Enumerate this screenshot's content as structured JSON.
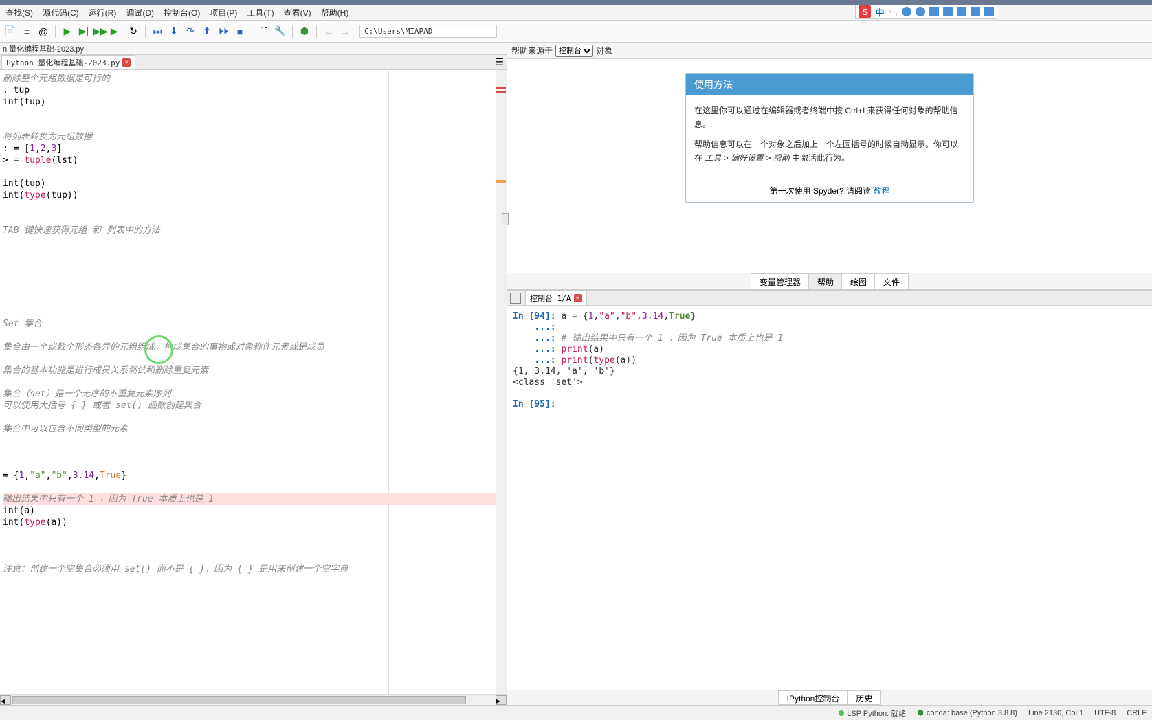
{
  "title_suffix": "8)",
  "floating_toolbar": {
    "s": "S",
    "ch": "中"
  },
  "menubar": [
    "查找(S)",
    "源代码(C)",
    "运行(R)",
    "调试(D)",
    "控制台(O)",
    "项目(P)",
    "工具(T)",
    "查看(V)",
    "帮助(H)"
  ],
  "toolbar_path": "C:\\Users\\MIAPAD",
  "editor": {
    "path_tab": "n 量化编程基础-2023.py",
    "tab": "Python 量化编程基础-2023.py",
    "lines": [
      {
        "cls": "comment",
        "t": "删除整个元组数据是可行的"
      },
      {
        "t": ". tup"
      },
      {
        "t": "int(tup)"
      },
      {
        "t": ""
      },
      {
        "t": ""
      },
      {
        "cls": "comment",
        "t": "将列表转换为元组数据"
      },
      {
        "html": ": = [<span class='num'>1</span>,<span class='num'>2</span>,<span class='num'>3</span>]"
      },
      {
        "html": "&gt; = <span class='builtin'>tuple</span>(lst)"
      },
      {
        "t": ""
      },
      {
        "t": "int(tup)"
      },
      {
        "html": "int(<span class='builtin'>type</span>(tup))"
      },
      {
        "t": ""
      },
      {
        "t": ""
      },
      {
        "cls": "comment",
        "t": "TAB 键快速获得元组 和 列表中的方法"
      },
      {
        "t": ""
      },
      {
        "t": ""
      },
      {
        "t": ""
      },
      {
        "t": ""
      },
      {
        "t": ""
      },
      {
        "t": ""
      },
      {
        "t": ""
      },
      {
        "cls": "comment",
        "t": "Set 集合"
      },
      {
        "t": ""
      },
      {
        "cls": "comment",
        "t": "集合由一个或数个形态各异的元组组成，构成集合的事物或对象称作元素或是成员"
      },
      {
        "t": ""
      },
      {
        "cls": "comment",
        "t": "集合的基本功能是进行成员关系测试和删除重复元素"
      },
      {
        "t": ""
      },
      {
        "cls": "comment",
        "t": "集合（set）是一个无序的不重复元素序列"
      },
      {
        "cls": "comment",
        "t": "可以使用大括号 { } 或者 set() 函数创建集合"
      },
      {
        "t": ""
      },
      {
        "cls": "comment",
        "t": "集合中可以包含不同类型的元素"
      },
      {
        "t": ""
      },
      {
        "t": ""
      },
      {
        "t": ""
      },
      {
        "html": "= {<span class='num'>1</span>,<span class='str'>\"a\"</span>,<span class='str'>\"b\"</span>,<span class='num'>3.14</span>,<span class='kw'>True</span>}"
      },
      {
        "t": ""
      },
      {
        "cls": "comment hilite",
        "t": "输出结果中只有一个 1 ，因为 True 本质上也是 1"
      },
      {
        "t": "int(a)"
      },
      {
        "html": "int(<span class='builtin'>type</span>(a))"
      },
      {
        "t": ""
      },
      {
        "t": ""
      },
      {
        "t": ""
      },
      {
        "cls": "comment",
        "t": "注意：创建一个空集合必须用 set() 而不是 { }，因为 { } 是用来创建一个空字典"
      }
    ]
  },
  "help": {
    "source_label": "帮助来源于",
    "source_options": [
      "控制台"
    ],
    "object_label": "对象",
    "card_title": "使用方法",
    "card_body1": "在这里你可以通过在编辑器或者终端中按 Ctrl+I 来获得任何对象的帮助信息。",
    "card_body2_a": "帮助信息可以在一个对象之后加上一个左圆括号的时候自动显示。你可以在 ",
    "card_body2_b": "工具 > 偏好设置 > 帮助",
    "card_body2_c": " 中激活此行为。",
    "card_footer_text": "第一次使用 Spyder? 请阅读 ",
    "card_footer_link": "教程",
    "tabs": [
      "变量管理器",
      "帮助",
      "绘图",
      "文件"
    ]
  },
  "console": {
    "tab": "控制台 1/A",
    "bottom_tabs": [
      "IPython控制台",
      "历史"
    ]
  },
  "statusbar": {
    "lsp": "LSP Python: 就绪",
    "conda": "conda: base (Python 3.8.8)",
    "line": "Line 2130, Col 1",
    "enc": "UTF-8",
    "eol": "CRLF"
  }
}
